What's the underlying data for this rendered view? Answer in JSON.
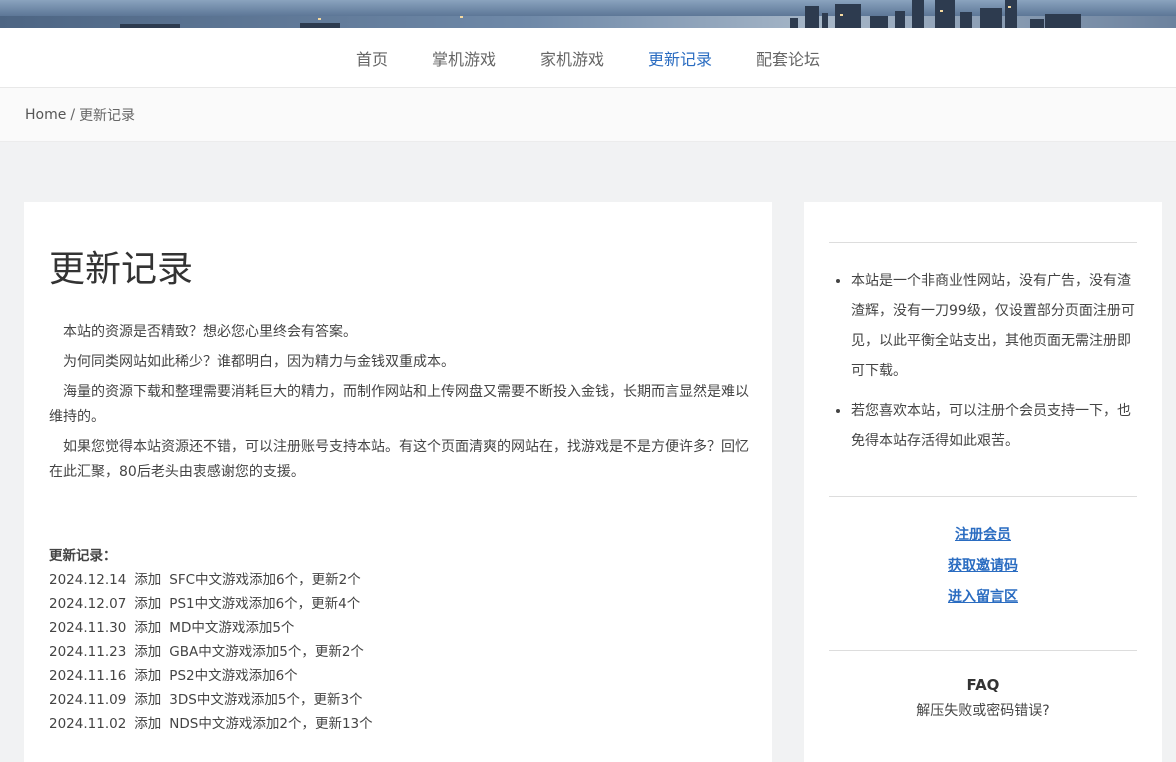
{
  "nav": {
    "items": [
      {
        "label": "首页",
        "active": false
      },
      {
        "label": "掌机游戏",
        "active": false
      },
      {
        "label": "家机游戏",
        "active": false
      },
      {
        "label": "更新记录",
        "active": true
      },
      {
        "label": "配套论坛",
        "active": false
      }
    ]
  },
  "breadcrumb": {
    "home": "Home",
    "sep": "/",
    "current": "更新记录"
  },
  "main": {
    "title": "更新记录",
    "intro": [
      "本站的资源是否精致？想必您心里终会有答案。",
      "为何同类网站如此稀少？谁都明白，因为精力与金钱双重成本。",
      "海量的资源下载和整理需要消耗巨大的精力，而制作网站和上传网盘又需要不断投入金钱，长期而言显然是难以维持的。",
      "如果您觉得本站资源还不错，可以注册账号支持本站。有这个页面清爽的网站在，找游戏是不是方便许多？回忆在此汇聚，80后老头由衷感谢您的支援。"
    ],
    "log_title": "更新记录：",
    "log": [
      {
        "date": "2024.12.14",
        "action": "添加",
        "text": "SFC中文游戏添加6个，更新2个"
      },
      {
        "date": "2024.12.07",
        "action": "添加",
        "text": "PS1中文游戏添加6个，更新4个"
      },
      {
        "date": "2024.11.30",
        "action": "添加",
        "text": "MD中文游戏添加5个"
      },
      {
        "date": "2024.11.23",
        "action": "添加",
        "text": "GBA中文游戏添加5个，更新2个"
      },
      {
        "date": "2024.11.16",
        "action": "添加",
        "text": "PS2中文游戏添加6个"
      },
      {
        "date": "2024.11.09",
        "action": "添加",
        "text": "3DS中文游戏添加5个，更新3个"
      },
      {
        "date": "2024.11.02",
        "action": "添加",
        "text": "NDS中文游戏添加2个，更新13个"
      }
    ]
  },
  "sidebar": {
    "notes": [
      "本站是一个非商业性网站，没有广告，没有渣渣辉，没有一刀99级，仅设置部分页面注册可见，以此平衡全站支出，其他页面无需注册即可下载。",
      "若您喜欢本站，可以注册个会员支持一下，也免得本站存活得如此艰苦。"
    ],
    "links": [
      "注册会员",
      "获取邀请码",
      "进入留言区"
    ],
    "faq_title": "FAQ",
    "faq_question": "解压失败或密码错误?"
  },
  "colors": {
    "accent": "#2a6cc1",
    "page_bg": "#f1f2f3"
  }
}
